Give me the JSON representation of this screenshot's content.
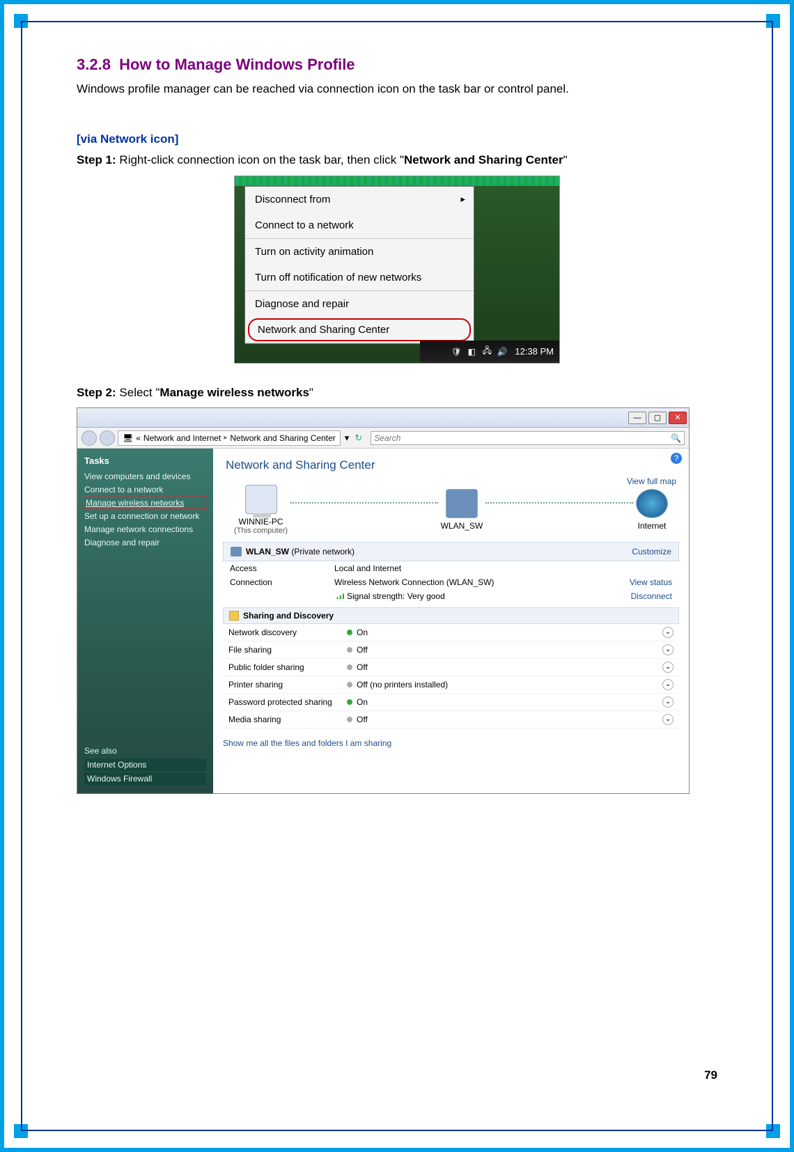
{
  "page": {
    "section_number": "3.2.8",
    "section_title": "How to Manage Windows Profile",
    "intro": "Windows profile manager can be reached via connection icon on the task bar or control panel.",
    "via_heading": "[via Network icon]",
    "step1_prefix": "Step 1:",
    "step1_mid": " Right-click connection icon on the task bar, then click \"",
    "step1_bold": "Network and Sharing Center",
    "step1_suffix": "\"",
    "step2_prefix": "Step 2:",
    "step2_mid": " Select \"",
    "step2_bold": "Manage wireless networks",
    "step2_suffix": "\"",
    "page_number": "79"
  },
  "context_menu": {
    "items": [
      {
        "label": "Disconnect from",
        "arrow": true
      },
      {
        "label": "Connect to a network"
      },
      {
        "label": "Turn on activity animation"
      },
      {
        "label": "Turn off notification of new networks"
      },
      {
        "label": "Diagnose and repair"
      },
      {
        "label": "Network and Sharing Center",
        "highlight": true
      }
    ],
    "taskbar": {
      "clock": "12:38 PM"
    }
  },
  "nsc": {
    "breadcrumb_prefix": "«",
    "breadcrumb_1": "Network and Internet",
    "breadcrumb_2": "Network and Sharing Center",
    "search_placeholder": "Search",
    "sidebar": {
      "tasks_title": "Tasks",
      "links": [
        "View computers and devices",
        "Connect to a network",
        "Manage wireless networks",
        "Set up a connection or network",
        "Manage network connections",
        "Diagnose and repair"
      ],
      "highlight_index": 2,
      "see_also_title": "See also",
      "see_also": [
        "Internet Options",
        "Windows Firewall"
      ]
    },
    "panel_title": "Network and Sharing Center",
    "view_full_map": "View full map",
    "nodes": {
      "pc_name": "WINNIE-PC",
      "pc_sub": "(This computer)",
      "router": "WLAN_SW",
      "internet": "Internet"
    },
    "wlan_header_name": "WLAN_SW",
    "wlan_header_suffix": " (Private network)",
    "wlan_customize": "Customize",
    "details": {
      "access_k": "Access",
      "access_v": "Local and Internet",
      "conn_k": "Connection",
      "conn_v": "Wireless Network Connection (WLAN_SW)",
      "view_status": "View status",
      "signal_label": "Signal strength:  Very good",
      "disconnect": "Disconnect"
    },
    "sd_title": "Sharing and Discovery",
    "sd_rows": [
      {
        "k": "Network discovery",
        "v": "On",
        "dot": "green"
      },
      {
        "k": "File sharing",
        "v": "Off",
        "dot": "grey"
      },
      {
        "k": "Public folder sharing",
        "v": "Off",
        "dot": "grey"
      },
      {
        "k": "Printer sharing",
        "v": "Off (no printers installed)",
        "dot": "grey"
      },
      {
        "k": "Password protected sharing",
        "v": "On",
        "dot": "green"
      },
      {
        "k": "Media sharing",
        "v": "Off",
        "dot": "grey"
      }
    ],
    "bottom_link": "Show me all the files and folders I am sharing"
  }
}
